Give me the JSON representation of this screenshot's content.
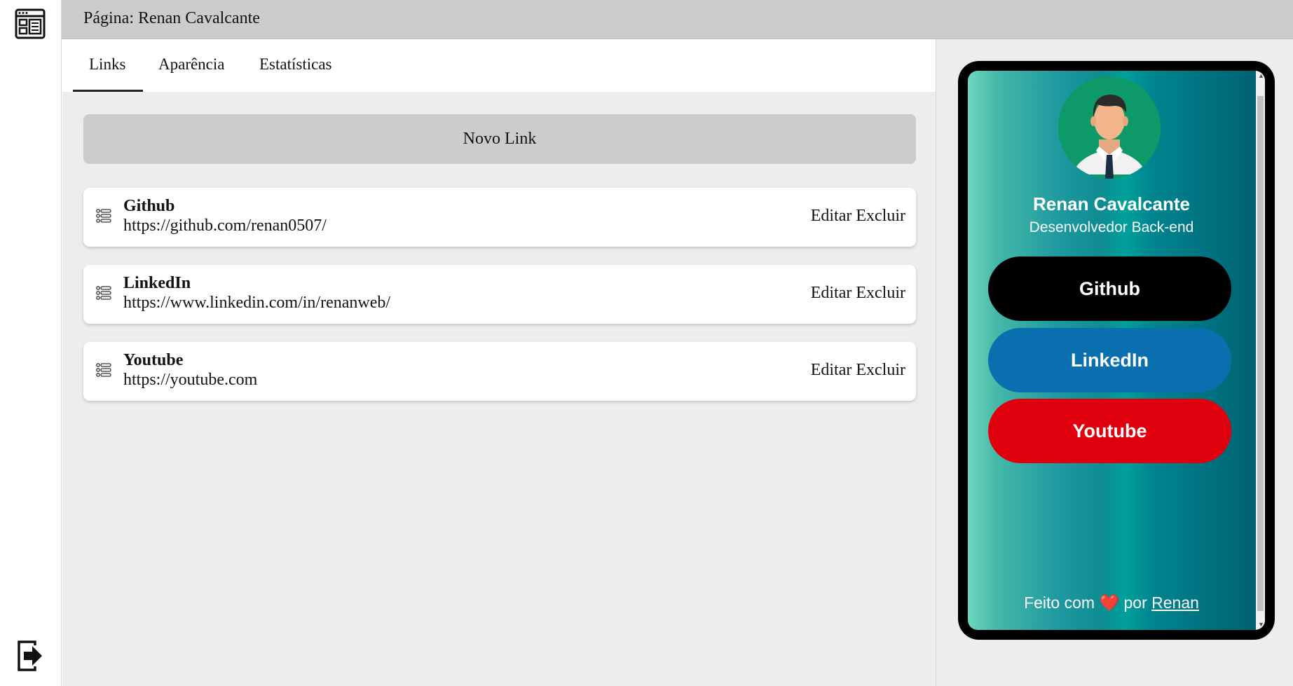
{
  "header": {
    "title": "Página: Renan Cavalcante"
  },
  "rail": {
    "app_icon": "layout-icon",
    "logout_icon": "logout-icon"
  },
  "tabs": [
    {
      "label": "Links",
      "active": true
    },
    {
      "label": "Aparência",
      "active": false
    },
    {
      "label": "Estatísticas",
      "active": false
    }
  ],
  "new_link_label": "Novo Link",
  "links": [
    {
      "title": "Github",
      "url": "https://github.com/renan0507/",
      "edit_label": "Editar",
      "delete_label": "Excluir"
    },
    {
      "title": "LinkedIn",
      "url": "https://www.linkedin.com/in/renanweb/",
      "edit_label": "Editar",
      "delete_label": "Excluir"
    },
    {
      "title": "Youtube",
      "url": "https://youtube.com",
      "edit_label": "Editar",
      "delete_label": "Excluir"
    }
  ],
  "preview": {
    "name": "Renan Cavalcante",
    "bio": "Desenvolvedor Back-end",
    "buttons": [
      {
        "label": "Github",
        "color": "#000000"
      },
      {
        "label": "LinkedIn",
        "color": "#0a6faf"
      },
      {
        "label": "Youtube",
        "color": "#e0000d"
      }
    ],
    "footer": {
      "prefix": "Feito com",
      "heart": "❤️",
      "middle": "por",
      "author": "Renan"
    }
  }
}
